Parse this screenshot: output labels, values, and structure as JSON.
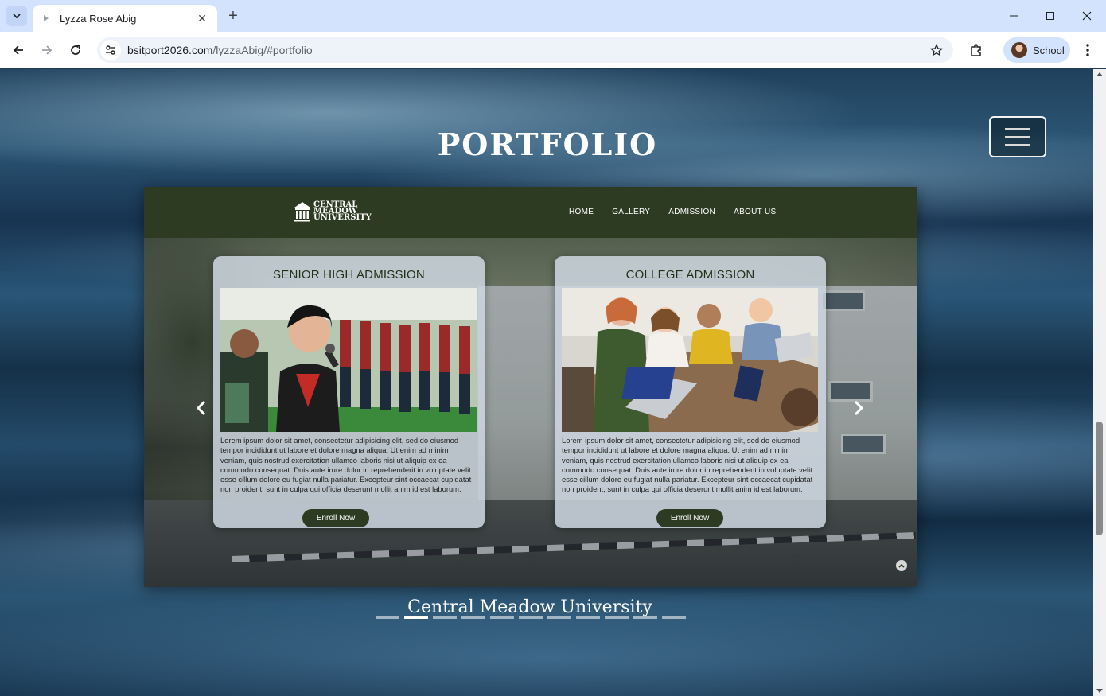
{
  "browser": {
    "tab_title": "Lyzza Rose Abig",
    "url_host": "bsitport2026.com",
    "url_path": "/lyzzaAbig/#portfolio",
    "profile_name": "School"
  },
  "page": {
    "title": "PORTFOLIO",
    "caption": "Central Meadow University",
    "indicator_count": 11,
    "active_indicator": 1
  },
  "site": {
    "logo_line1": "CENTRAL",
    "logo_line2": "MEADOW",
    "logo_line3": "UNIVERSITY",
    "menu": [
      "HOME",
      "GALLERY",
      "ADMISSION",
      "ABOUT US"
    ]
  },
  "cards": [
    {
      "title": "SENIOR HIGH ADMISSION",
      "body": "Lorem ipsum dolor sit amet, consectetur adipisicing elit, sed do eiusmod tempor incididunt ut labore et dolore magna aliqua. Ut enim ad minim veniam, quis nostrud exercitation ullamco laboris nisi ut aliquip ex ea commodo consequat. Duis aute irure dolor in reprehenderit in voluptate velit esse cillum dolore eu fugiat nulla pariatur. Excepteur sint occaecat cupidatat non proident, sunt in culpa qui officia deserunt mollit anim id est laborum.",
      "button": "Enroll Now"
    },
    {
      "title": "COLLEGE ADMISSION",
      "body": "Lorem ipsum dolor sit amet, consectetur adipisicing elit, sed do eiusmod tempor incididunt ut labore et dolore magna aliqua. Ut enim ad minim veniam, quis nostrud exercitation ullamco laboris nisi ut aliquip ex ea commodo consequat. Duis aute irure dolor in reprehenderit in voluptate velit esse cillum dolore eu fugiat nulla pariatur. Excepteur sint occaecat cupidatat non proident, sunt in culpa qui officia deserunt mollit anim id est laborum.",
      "button": "Enroll Now"
    }
  ],
  "colors": {
    "brand_green": "#2c3b22",
    "card_title": "#1e3217"
  }
}
